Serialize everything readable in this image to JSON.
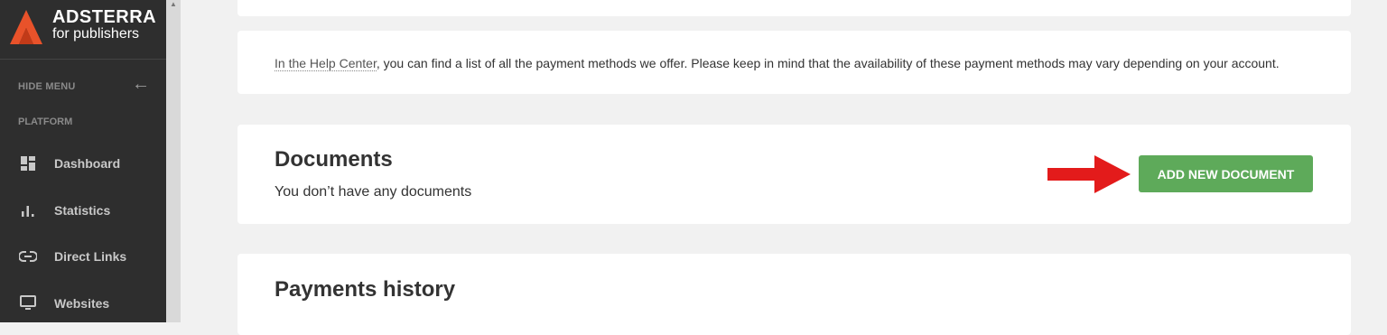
{
  "sidebar": {
    "brand_title": "ADSTERRA",
    "brand_subtitle": "for publishers",
    "hide_menu_label": "HIDE MENU",
    "section_label": "PLATFORM",
    "items": [
      {
        "label": "Dashboard",
        "icon": "dashboard-icon"
      },
      {
        "label": "Statistics",
        "icon": "statistics-icon"
      },
      {
        "label": "Direct Links",
        "icon": "link-icon"
      },
      {
        "label": "Websites",
        "icon": "monitor-icon"
      }
    ]
  },
  "help": {
    "link_text": "In the Help Center",
    "text": ", you can find a list of all the payment methods we offer. Please keep in mind that the availability of these payment methods may vary depending on your account."
  },
  "documents": {
    "title": "Documents",
    "empty_text": "You don’t have any documents",
    "add_button_label": "ADD NEW DOCUMENT"
  },
  "payments": {
    "title": "Payments history"
  },
  "colors": {
    "sidebar_bg": "#2e2e2e",
    "brand_accent": "#e8522a",
    "button_green": "#5eaa5a",
    "arrow_red": "#e31b1b"
  }
}
